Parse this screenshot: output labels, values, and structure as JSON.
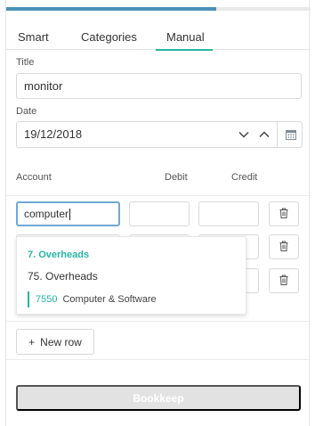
{
  "progress": {
    "value_percent": 69,
    "fill_color": "#4a90b8"
  },
  "tabs": [
    {
      "label": "Smart",
      "active": false
    },
    {
      "label": "Categories",
      "active": false
    },
    {
      "label": "Manual",
      "active": true
    }
  ],
  "form": {
    "title_label": "Title",
    "title_value": "monitor",
    "date_label": "Date",
    "date_value": "19/12/2018",
    "date_icons": [
      "chevron-down-icon",
      "chevron-up-icon",
      "calendar-icon"
    ]
  },
  "table": {
    "headers": {
      "account": "Account",
      "debit": "Debit",
      "credit": "Credit"
    },
    "rows": [
      {
        "account": "computer",
        "debit": "",
        "credit": ""
      },
      {
        "account": "",
        "debit": "",
        "credit": ""
      },
      {
        "account": "",
        "debit": "",
        "credit": ""
      }
    ]
  },
  "dropdown": {
    "group": "7. Overheads",
    "subgroup": "75. Overheads",
    "item_code": "7550",
    "item_name": "Computer & Software"
  },
  "buttons": {
    "new_row": "New row",
    "new_row_icon": "+",
    "bookkeep": "Bookkeep"
  },
  "colors": {
    "accent": "#26b5a4",
    "focus": "#6fa8d6",
    "disabled_button": "#e2e2e2"
  }
}
